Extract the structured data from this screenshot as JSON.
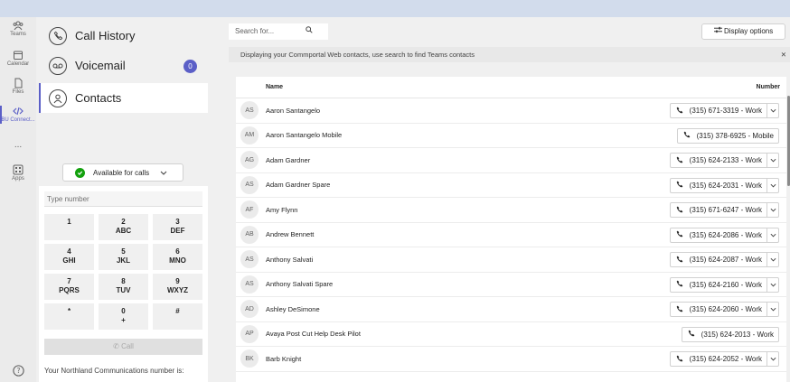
{
  "rail": {
    "items": [
      {
        "label": "Teams",
        "icon": "teams-icon"
      },
      {
        "label": "Calendar",
        "icon": "calendar-icon"
      },
      {
        "label": "Files",
        "icon": "files-icon"
      },
      {
        "label": "BU Connect...",
        "icon": "bu-connect-icon"
      },
      {
        "label": "...",
        "icon": "more-icon"
      },
      {
        "label": "Apps",
        "icon": "apps-icon"
      }
    ],
    "help_icon": "help-icon"
  },
  "nav": {
    "call_history": "Call History",
    "voicemail": "Voicemail",
    "voicemail_count": "0",
    "contacts": "Contacts"
  },
  "status": {
    "label": "Available for calls",
    "color": "#13a10e"
  },
  "dialpad": {
    "placeholder": "Type number",
    "keys": [
      {
        "num": "1",
        "sub": ""
      },
      {
        "num": "2",
        "sub": "ABC"
      },
      {
        "num": "3",
        "sub": "DEF"
      },
      {
        "num": "4",
        "sub": "GHI"
      },
      {
        "num": "5",
        "sub": "JKL"
      },
      {
        "num": "6",
        "sub": "MNO"
      },
      {
        "num": "7",
        "sub": "PQRS"
      },
      {
        "num": "8",
        "sub": "TUV"
      },
      {
        "num": "9",
        "sub": "WXYZ"
      },
      {
        "num": "*",
        "sub": ""
      },
      {
        "num": "0",
        "sub": "+"
      },
      {
        "num": "#",
        "sub": ""
      }
    ],
    "call_label": "Call",
    "northland_text": "Your Northland Communications number is:"
  },
  "toolbar": {
    "search_placeholder": "Search for...",
    "display_options": "Display options"
  },
  "info_bar": "Displaying your Commportal Web contacts, use search to find Teams contacts",
  "table": {
    "col_name": "Name",
    "col_number": "Number",
    "rows": [
      {
        "initials": "AS",
        "name": "Aaron Santangelo",
        "number": "(315) 671-3319 - Work",
        "caret": true
      },
      {
        "initials": "AM",
        "name": "Aaron Santangelo Mobile",
        "number": "(315) 378-6925 - Mobile",
        "caret": false
      },
      {
        "initials": "AG",
        "name": "Adam Gardner",
        "number": "(315) 624-2133 - Work",
        "caret": true
      },
      {
        "initials": "AS",
        "name": "Adam Gardner Spare",
        "number": "(315) 624-2031 - Work",
        "caret": true
      },
      {
        "initials": "AF",
        "name": "Amy Flynn",
        "number": "(315) 671-6247 - Work",
        "caret": true
      },
      {
        "initials": "AB",
        "name": "Andrew Bennett",
        "number": "(315) 624-2086 - Work",
        "caret": true
      },
      {
        "initials": "AS",
        "name": "Anthony Salvati",
        "number": "(315) 624-2087 - Work",
        "caret": true
      },
      {
        "initials": "AS",
        "name": "Anthony Salvati Spare",
        "number": "(315) 624-2160 - Work",
        "caret": true
      },
      {
        "initials": "AD",
        "name": "Ashley DeSimone",
        "number": "(315) 624-2060 - Work",
        "caret": true
      },
      {
        "initials": "AP",
        "name": "Avaya Post Cut Help Desk Pilot",
        "number": "(315) 624-2013 - Work",
        "caret": false
      },
      {
        "initials": "BK",
        "name": "Barb Knight",
        "number": "(315) 624-2052 - Work",
        "caret": true
      }
    ]
  }
}
